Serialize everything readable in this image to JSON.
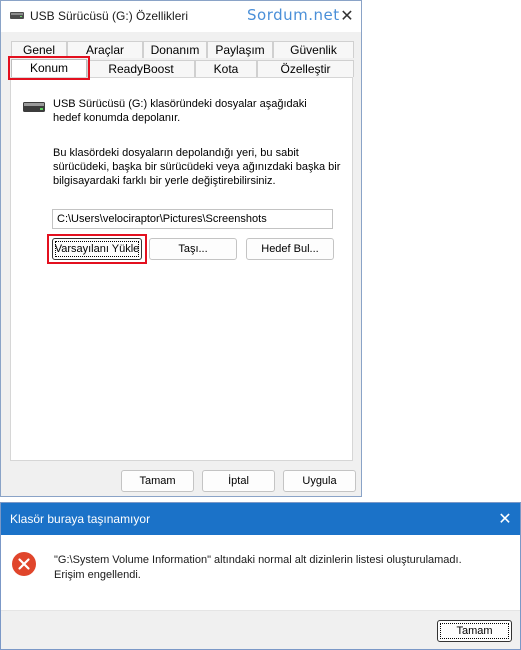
{
  "properties_dialog": {
    "title": "USB Sürücüsü (G:) Özellikleri",
    "watermark": "Sordum.net",
    "close_glyph": "✕",
    "tabs_row1": [
      "Genel",
      "Araçlar",
      "Donanım",
      "Paylaşım",
      "Güvenlik"
    ],
    "tabs_row2": [
      "Konum",
      "ReadyBoost",
      "Kota",
      "Özelleştir"
    ],
    "active_tab": "Konum",
    "description": [
      "USB Sürücüsü (G:) klasöründeki dosyalar aşağıdaki",
      "hedef konumda depolanır."
    ],
    "explanation": [
      "Bu klasördeki dosyaların depolandığı yeri, bu sabit",
      "sürücüdeki, başka bir sürücüdeki veya ağınızdaki başka bir",
      "bilgisayardaki farklı bir yerle değiştirebilirsiniz."
    ],
    "path_value": "C:\\Users\\velociraptor\\Pictures\\Screenshots",
    "buttons": {
      "restore_default": "Varsayılanı Yükle",
      "move": "Taşı...",
      "find_target": "Hedef Bul..."
    },
    "footer_buttons": {
      "ok": "Tamam",
      "cancel": "İptal",
      "apply": "Uygula"
    },
    "icons": {
      "drive": "usb-drive-icon",
      "close": "close-icon"
    }
  },
  "error_dialog": {
    "title": "Klasör buraya taşınamıyor",
    "close_glyph": "✕",
    "message_line1": "\"G:\\System Volume Information\" altındaki normal alt dizinlerin listesi oluşturulamadı.",
    "message_line2": "Erişim engellendi.",
    "ok_button": "Tamam",
    "icons": {
      "error": "error-icon"
    },
    "colors": {
      "titlebar": "#1b72c8",
      "error_icon": "#e0452b"
    }
  },
  "highlight_color": "#e3101f"
}
